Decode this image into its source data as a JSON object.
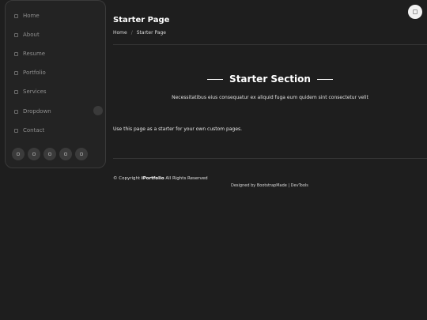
{
  "sidebar": {
    "items": [
      {
        "label": "Home",
        "icon": "house-icon"
      },
      {
        "label": "About",
        "icon": "person-icon"
      },
      {
        "label": "Resume",
        "icon": "file-icon"
      },
      {
        "label": "Portfolio",
        "icon": "images-icon"
      },
      {
        "label": "Services",
        "icon": "hdd-stack-icon"
      },
      {
        "label": "Dropdown",
        "icon": "menu-icon"
      },
      {
        "label": "Contact",
        "icon": "envelope-icon"
      }
    ],
    "socials": [
      "twitter-icon",
      "facebook-icon",
      "instagram-icon",
      "skype-icon",
      "linkedin-icon"
    ]
  },
  "header": {
    "title": "Starter Page",
    "breadcrumbs": [
      "Home",
      "Starter Page"
    ],
    "separator": "/"
  },
  "section": {
    "title": "Starter Section",
    "subtitle": "Necessitatibus eius consequatur ex aliquid fuga eum quidem sint consectetur velit",
    "body": "Use this page as a starter for your own custom pages."
  },
  "footer": {
    "copyright_prefix": "© Copyright",
    "brand": "iPortfolio",
    "rights": "All Rights Reserved",
    "credits": "Designed by BootstrapMade | DevTools"
  },
  "colors": {
    "background": "#1e1e1e",
    "sidebar_bg": "#232323",
    "text": "#e6e6e6",
    "accent": "#ffffff"
  }
}
